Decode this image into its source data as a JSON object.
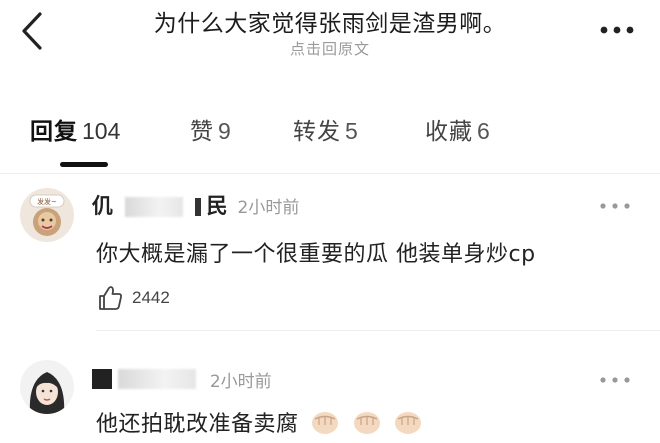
{
  "header": {
    "title": "为什么大家觉得张雨剑是渣男啊。",
    "subtitle": "点击回原文",
    "back_icon": "chevron-left-icon",
    "more_icon": "more-dots-icon"
  },
  "tabs": [
    {
      "label": "回复",
      "count": "104",
      "active": true
    },
    {
      "label": "赞",
      "count": "9",
      "active": false
    },
    {
      "label": "转发",
      "count": "5",
      "active": false
    },
    {
      "label": "收藏",
      "count": "6",
      "active": false
    }
  ],
  "comments": [
    {
      "username_visible_start": "仉",
      "username_visible_end": "民",
      "timestamp": "2小时前",
      "text": "你大概是漏了一个很重要的瓜 他装单身炒cp",
      "likes": "2442",
      "avatar_badge_text": "发发~"
    },
    {
      "timestamp": "2小时前",
      "text": "他还拍耽改准备卖腐",
      "emoji": "fist-bump-emoji"
    }
  ],
  "colors": {
    "text_primary": "#222222",
    "text_muted": "#999999",
    "divider": "#ececec",
    "indicator": "#111111"
  }
}
